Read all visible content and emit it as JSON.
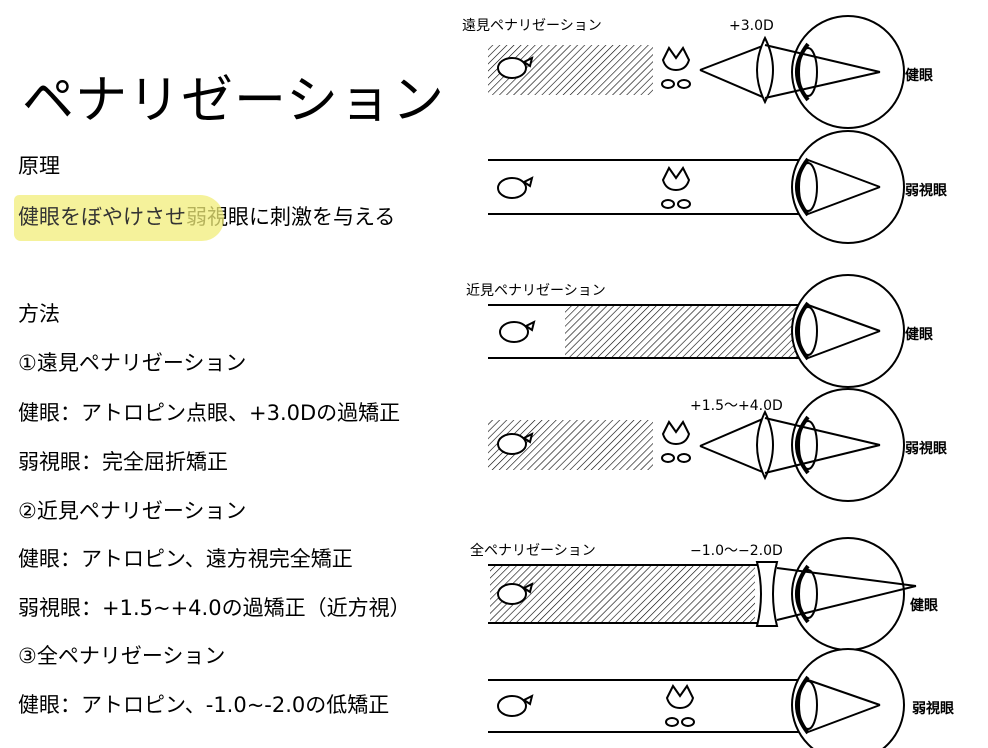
{
  "slide": {
    "title": "ペナリゼーション",
    "principle_heading": "原理",
    "principle_highlight": "健眼をぼやけさせ",
    "principle_rest": "弱視眼に刺激を与える",
    "method_heading": "方法",
    "methods": [
      "①遠見ペナリゼーション",
      "健眼：アトロピン点眼、+3.0Dの過矯正",
      "弱視眼：完全屈折矯正",
      "②近見ペナリゼーション",
      "健眼：アトロピン、遠方視完全矯正",
      "弱視眼：+1.5~+4.0の過矯正（近方視）",
      "③全ペナリゼーション",
      "健眼：アトロピン、-1.0~-2.0の低矯正"
    ]
  },
  "diagram": {
    "far_label": "遠見ペナリゼーション",
    "far_lens": "+3.0D",
    "near_label": "近見ペナリゼーション",
    "near_lens": "+1.5～+4.0D",
    "total_label": "全ペナリゼーション",
    "total_lens": "−1.0～−2.0D",
    "eye_healthy": "健眼",
    "eye_amblyopic": "弱視眼"
  },
  "colors": {
    "highlight": "#f2ee7a",
    "text": "#000000"
  }
}
